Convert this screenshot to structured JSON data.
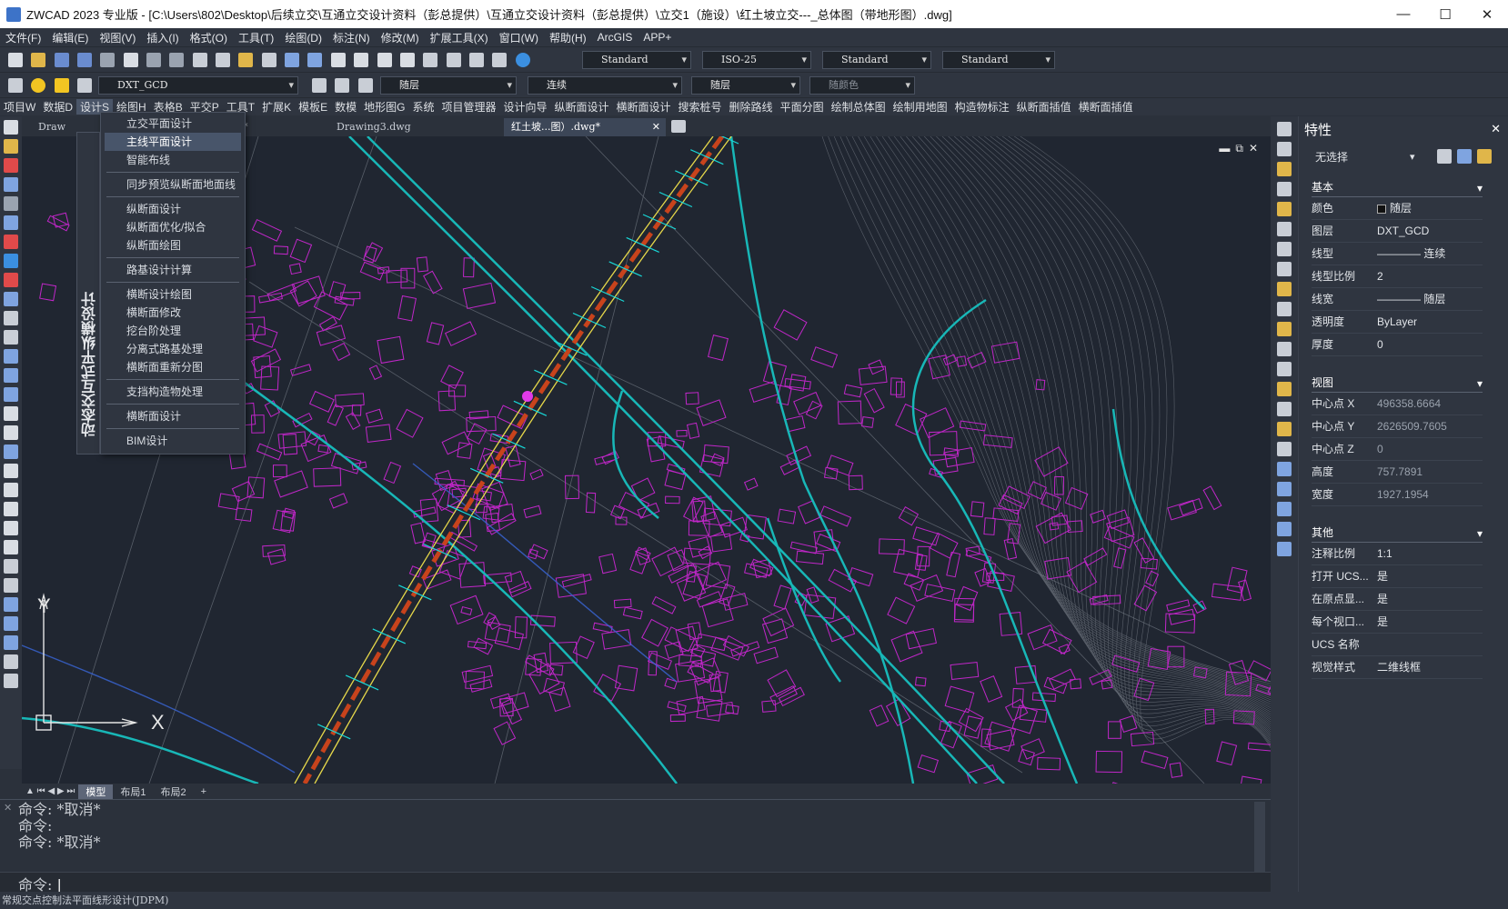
{
  "title_bar": {
    "title": "ZWCAD 2023 专业版 - [C:\\Users\\802\\Desktop\\后续立交\\互通立交设计资料（彭总提供）\\互通立交设计资料（彭总提供）\\立交1（施设）\\红土坡立交---_总体图（带地形图）.dwg]",
    "minimize": "—",
    "maximize": "☐",
    "close": "✕"
  },
  "menu_bar": [
    "文件(F)",
    "编辑(E)",
    "视图(V)",
    "插入(I)",
    "格式(O)",
    "工具(T)",
    "绘图(D)",
    "标注(N)",
    "修改(M)",
    "扩展工具(X)",
    "窗口(W)",
    "帮助(H)",
    "ArcGIS",
    "APP+"
  ],
  "toolbar1": {
    "text_style": "Standard",
    "dim_style": "ISO-25",
    "table_style": "Standard",
    "multileader_style": "Standard"
  },
  "toolbar2": {
    "layer": "DXT_GCD",
    "color": "随层",
    "linetype": "连续",
    "lineweight": "随层",
    "plot_style": "随颜色"
  },
  "ribbon_tabs": [
    "项目W",
    "数据D",
    "设计S",
    "绘图H",
    "表格B",
    "平交P",
    "工具T",
    "扩展K",
    "模板E",
    "数模",
    "地形图G",
    "系统",
    "项目管理器",
    "设计向导",
    "纵断面设计",
    "横断面设计",
    "搜索桩号",
    "删除路线",
    "平面分图",
    "绘制总体图",
    "绘制用地图",
    "构造物标注",
    "纵断面插值",
    "横断面插值"
  ],
  "active_ribbon_tab": "设计S",
  "doc_tabs": [
    {
      "label": "Draw",
      "active": false
    },
    {
      "label": "g*",
      "active": false
    },
    {
      "label": "Drawing3.dwg",
      "active": false
    },
    {
      "label": "红土坡...图）.dwg*",
      "active": true
    }
  ],
  "design_menu": {
    "vertical_title": "动态交互式平纵横设计",
    "groups": [
      [
        "立交平面设计",
        "主线平面设计",
        "智能布线"
      ],
      [
        "同步预览纵断面地面线"
      ],
      [
        "纵断面设计",
        "纵断面优化/拟合",
        "纵断面绘图"
      ],
      [
        "路基设计计算"
      ],
      [
        "横断设计绘图",
        "横断面修改",
        "挖台阶处理",
        "分离式路基处理",
        "横断面重新分图"
      ],
      [
        "支挡构造物处理"
      ],
      [
        "横断面设计"
      ],
      [
        "BIM设计"
      ]
    ],
    "highlighted": "主线平面设计"
  },
  "ucs": {
    "x": "X",
    "y": "Y"
  },
  "layout_tabs": [
    "模型",
    "布局1",
    "布局2",
    "+"
  ],
  "active_layout": "模型",
  "command_history": [
    "命令: *取消*",
    "命令:",
    "命令: *取消*"
  ],
  "command_prompt": "命令:",
  "status_text": "常规交点控制法平面线形设计(JDPM)",
  "properties": {
    "title": "特性",
    "selection": "无选择",
    "sections": [
      {
        "name": "基本",
        "rows": [
          {
            "k": "颜色",
            "v": "随层"
          },
          {
            "k": "图层",
            "v": "DXT_GCD"
          },
          {
            "k": "线型",
            "v": "———— 连续"
          },
          {
            "k": "线型比例",
            "v": "2"
          },
          {
            "k": "线宽",
            "v": "———— 随层"
          },
          {
            "k": "透明度",
            "v": "ByLayer"
          },
          {
            "k": "厚度",
            "v": "0"
          }
        ]
      },
      {
        "name": "视图",
        "rows": [
          {
            "k": "中心点 X",
            "v": "496358.6664"
          },
          {
            "k": "中心点 Y",
            "v": "2626509.7605"
          },
          {
            "k": "中心点 Z",
            "v": "0"
          },
          {
            "k": "高度",
            "v": "757.7891"
          },
          {
            "k": "宽度",
            "v": "1927.1954"
          }
        ]
      },
      {
        "name": "其他",
        "rows": [
          {
            "k": "注释比例",
            "v": "1:1"
          },
          {
            "k": "打开 UCS...",
            "v": "是"
          },
          {
            "k": "在原点显...",
            "v": "是"
          },
          {
            "k": "每个视口...",
            "v": "是"
          },
          {
            "k": "UCS 名称",
            "v": ""
          },
          {
            "k": "视觉样式",
            "v": "二维线框"
          }
        ]
      }
    ]
  },
  "colors": {
    "canvas": "#202631",
    "road_centerline": "#c8431c",
    "road_edge": "#e6d84a",
    "buildings": "#c026c8",
    "rivers": "#18b7b7",
    "contours": "#8a9099",
    "panel": "#2f3540"
  }
}
